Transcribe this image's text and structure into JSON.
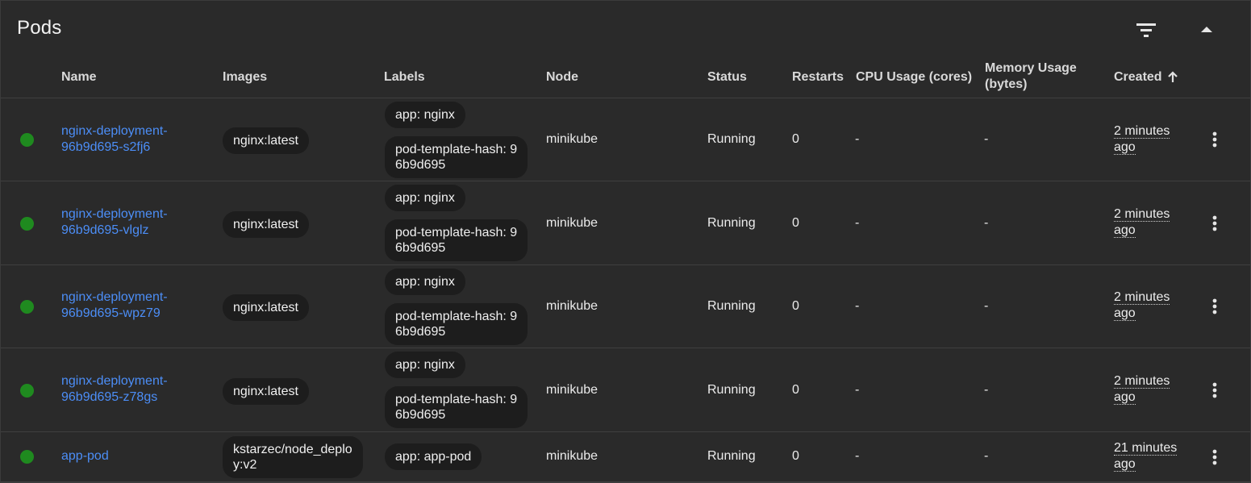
{
  "title": "Pods",
  "header_icons": {
    "filter": "filter-icon",
    "collapse": "chevron-up-icon"
  },
  "columns": {
    "name": "Name",
    "images": "Images",
    "labels": "Labels",
    "node": "Node",
    "status": "Status",
    "restarts": "Restarts",
    "cpu_usage": "CPU Usage (cores)",
    "memory_usage_1": "Memory Usage",
    "memory_usage_2": "(bytes)",
    "created": "Created"
  },
  "sort": {
    "column": "Created",
    "direction": "ascending",
    "icon": "arrow-up-icon"
  },
  "colors": {
    "status_running": "#1f8a1f",
    "link": "#4c8ef7",
    "chip_bg": "#1d1d1d"
  },
  "rows": [
    {
      "name_1": "nginx-deployment-",
      "name_2": "96b9d695-s2fj6",
      "image_1": "nginx:latest",
      "label_app": "app: nginx",
      "label_hash_1": "pod-template-hash: 9",
      "label_hash_2": "6b9d695",
      "node": "minikube",
      "status": "Running",
      "restarts": "0",
      "cpu": "-",
      "memory": "-",
      "created_1": "2 minutes",
      "created_2": "ago"
    },
    {
      "name_1": "nginx-deployment-",
      "name_2": "96b9d695-vlglz",
      "image_1": "nginx:latest",
      "label_app": "app: nginx",
      "label_hash_1": "pod-template-hash: 9",
      "label_hash_2": "6b9d695",
      "node": "minikube",
      "status": "Running",
      "restarts": "0",
      "cpu": "-",
      "memory": "-",
      "created_1": "2 minutes",
      "created_2": "ago"
    },
    {
      "name_1": "nginx-deployment-",
      "name_2": "96b9d695-wpz79",
      "image_1": "nginx:latest",
      "label_app": "app: nginx",
      "label_hash_1": "pod-template-hash: 9",
      "label_hash_2": "6b9d695",
      "node": "minikube",
      "status": "Running",
      "restarts": "0",
      "cpu": "-",
      "memory": "-",
      "created_1": "2 minutes",
      "created_2": "ago"
    },
    {
      "name_1": "nginx-deployment-",
      "name_2": "96b9d695-z78gs",
      "image_1": "nginx:latest",
      "label_app": "app: nginx",
      "label_hash_1": "pod-template-hash: 9",
      "label_hash_2": "6b9d695",
      "node": "minikube",
      "status": "Running",
      "restarts": "0",
      "cpu": "-",
      "memory": "-",
      "created_1": "2 minutes",
      "created_2": "ago"
    },
    {
      "name_1": "app-pod",
      "image_1": "kstarzec/node_deplo",
      "image_2": "y:v2",
      "label_app": "app: app-pod",
      "node": "minikube",
      "status": "Running",
      "restarts": "0",
      "cpu": "-",
      "memory": "-",
      "created_1": "21 minutes",
      "created_2": "ago"
    }
  ]
}
